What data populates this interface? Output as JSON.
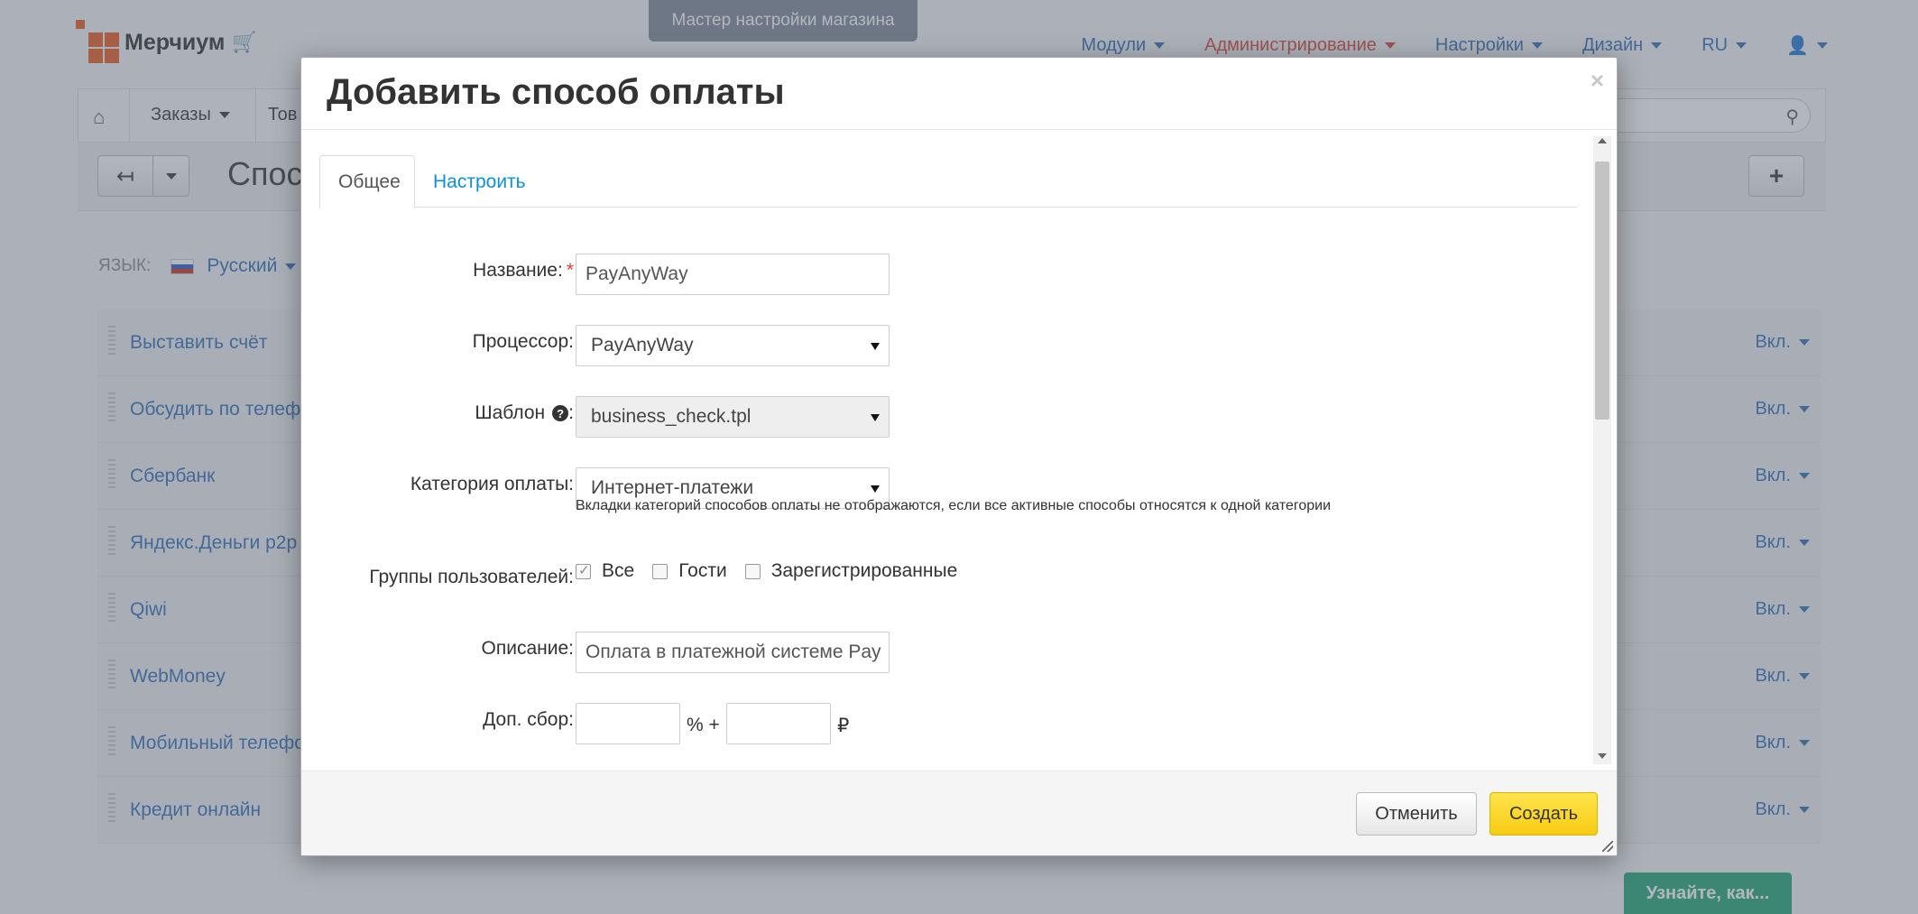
{
  "app": {
    "brand": "Мерчиум",
    "wizard": "Мастер настройки магазина",
    "topnav": [
      {
        "label": "Модули"
      },
      {
        "label": "Администрирование"
      },
      {
        "label": "Настройки"
      },
      {
        "label": "Дизайн"
      },
      {
        "label": "RU"
      }
    ],
    "menubar": [
      {
        "label": "Заказы"
      },
      {
        "label": "Тов"
      }
    ],
    "page_title": "Спос",
    "language": {
      "label": "ЯЗЫК:",
      "value": "Русский"
    },
    "payments": [
      {
        "name": "Выставить счёт",
        "status": "Вкл."
      },
      {
        "name": "Обсудить по телеф",
        "status": "Вкл."
      },
      {
        "name": "Сбербанк",
        "status": "Вкл."
      },
      {
        "name": "Яндекс.Деньги p2p",
        "status": "Вкл."
      },
      {
        "name": "Qiwi",
        "status": "Вкл."
      },
      {
        "name": "WebMoney",
        "status": "Вкл."
      },
      {
        "name": "Мобильный телефо",
        "status": "Вкл."
      },
      {
        "name": "Кредит онлайн",
        "status": "Вкл."
      }
    ],
    "learn_button": "Узнайте, как..."
  },
  "modal": {
    "title": "Добавить способ оплаты",
    "close": "×",
    "tabs": [
      {
        "label": "Общее",
        "active": true
      },
      {
        "label": "Настроить",
        "active": false
      }
    ],
    "form": {
      "name_label": "Название:",
      "name_required": "*",
      "name_value": "PayAnyWay",
      "processor_label": "Процессор:",
      "processor_value": "PayAnyWay",
      "template_label": "Шаблон",
      "template_colon": ":",
      "template_value": "business_check.tpl",
      "category_label": "Категория оплаты:",
      "category_value": "Интернет-платежи",
      "category_hint": "Вкладки категорий способов оплаты не отображаются, если все активные способы относятся к одной категории",
      "groups_label": "Группы пользователей:",
      "groups": [
        {
          "label": "Все",
          "checked": true
        },
        {
          "label": "Гости",
          "checked": false
        },
        {
          "label": "Зарегистрированные",
          "checked": false
        }
      ],
      "description_label": "Описание:",
      "description_value": "Оплата в платежной системе Pay",
      "fee_label": "Доп. сбор:",
      "fee_percent_value": "",
      "fee_fixed_value": "",
      "fee_plus": "% +",
      "currency": "₽"
    },
    "footer": {
      "cancel": "Отменить",
      "create": "Создать"
    }
  },
  "colors": {
    "accent_blue": "#2a6bb7",
    "admin_red": "#d8412f",
    "create_yellow": "#f7cc12",
    "learn_green": "#1ea672"
  }
}
